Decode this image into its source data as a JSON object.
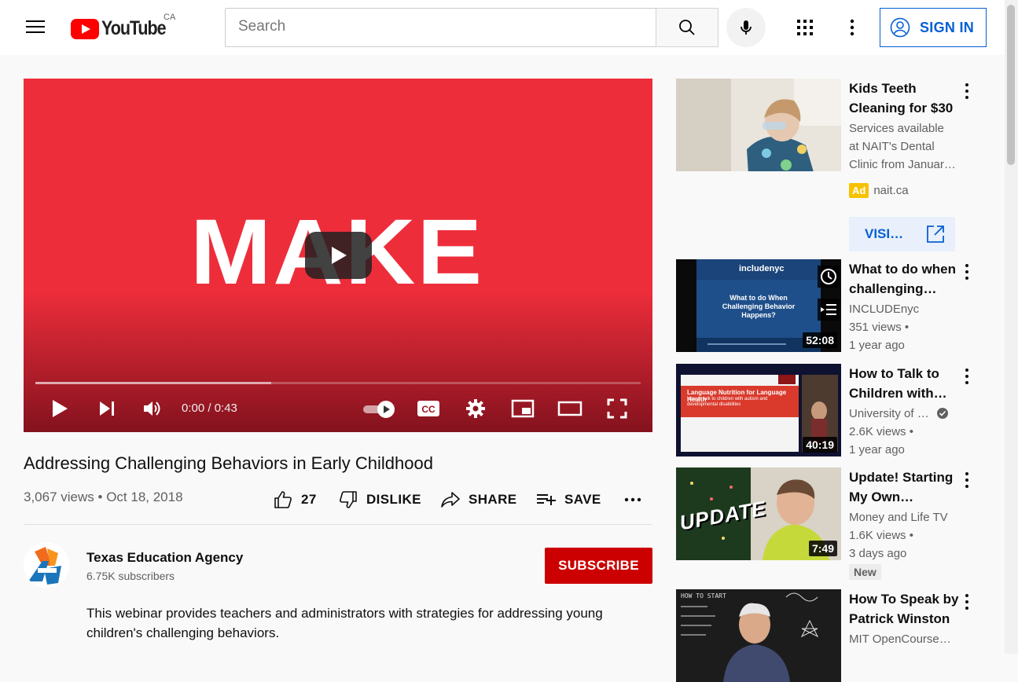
{
  "header": {
    "logo_text": "YouTube",
    "country": "CA",
    "search_placeholder": "Search",
    "signin_label": "SIGN IN"
  },
  "player": {
    "frame_text": "MAKE",
    "time": "0:00 / 0:43",
    "progress_fraction": 0.0,
    "buffered_fraction": 0.39,
    "colors": {
      "frame_bg": "#ee2d3b"
    }
  },
  "video": {
    "title": "Addressing Challenging Behaviors in Early Childhood",
    "views": "3,067 views",
    "date": "Oct 18, 2018",
    "likes": "27",
    "dislike_label": "DISLIKE",
    "share_label": "SHARE",
    "save_label": "SAVE"
  },
  "channel": {
    "name": "Texas Education Agency",
    "subscribers": "6.75K subscribers",
    "subscribe_label": "SUBSCRIBE",
    "description": "This webinar provides teachers and administrators with strategies for addressing young children's challenging behaviors."
  },
  "sidebar": {
    "ad": {
      "title_line1": "Kids Teeth",
      "title_line2": "Cleaning for $30",
      "desc1": "Services available",
      "desc2": "at NAIT's Dental",
      "desc3": "Clinic from Januar…",
      "badge": "Ad",
      "domain": "nait.ca",
      "visit_label": "VISI…"
    },
    "items": [
      {
        "title_line1": "What to do when",
        "title_line2": "challenging…",
        "channel": "INCLUDEnyc",
        "views": "351 views •",
        "age": "1 year ago",
        "duration": "52:08",
        "thumb_logo": "includenyc",
        "thumb_title": "What to do When Challenging Behavior Happens?"
      },
      {
        "title_line1": "How to Talk to",
        "title_line2": "Children with…",
        "channel": "University of …",
        "views": "2.6K views •",
        "age": "1 year ago",
        "duration": "40:19",
        "thumb_title": "Language Nutrition for Language Health",
        "thumb_sub": "How to talk to children with autism and developmental disabilities"
      },
      {
        "title_line1": "Update! Starting",
        "title_line2": "My Own…",
        "channel": "Money and Life TV",
        "views": "1.6K views •",
        "age": "3 days ago",
        "duration": "7:49",
        "badge": "New",
        "thumb_text": "UPDATE"
      },
      {
        "title_line1": "How To Speak by",
        "title_line2": "Patrick Winston",
        "channel": "MIT OpenCourseW…",
        "thumb_text": "HOW TO START"
      }
    ]
  }
}
